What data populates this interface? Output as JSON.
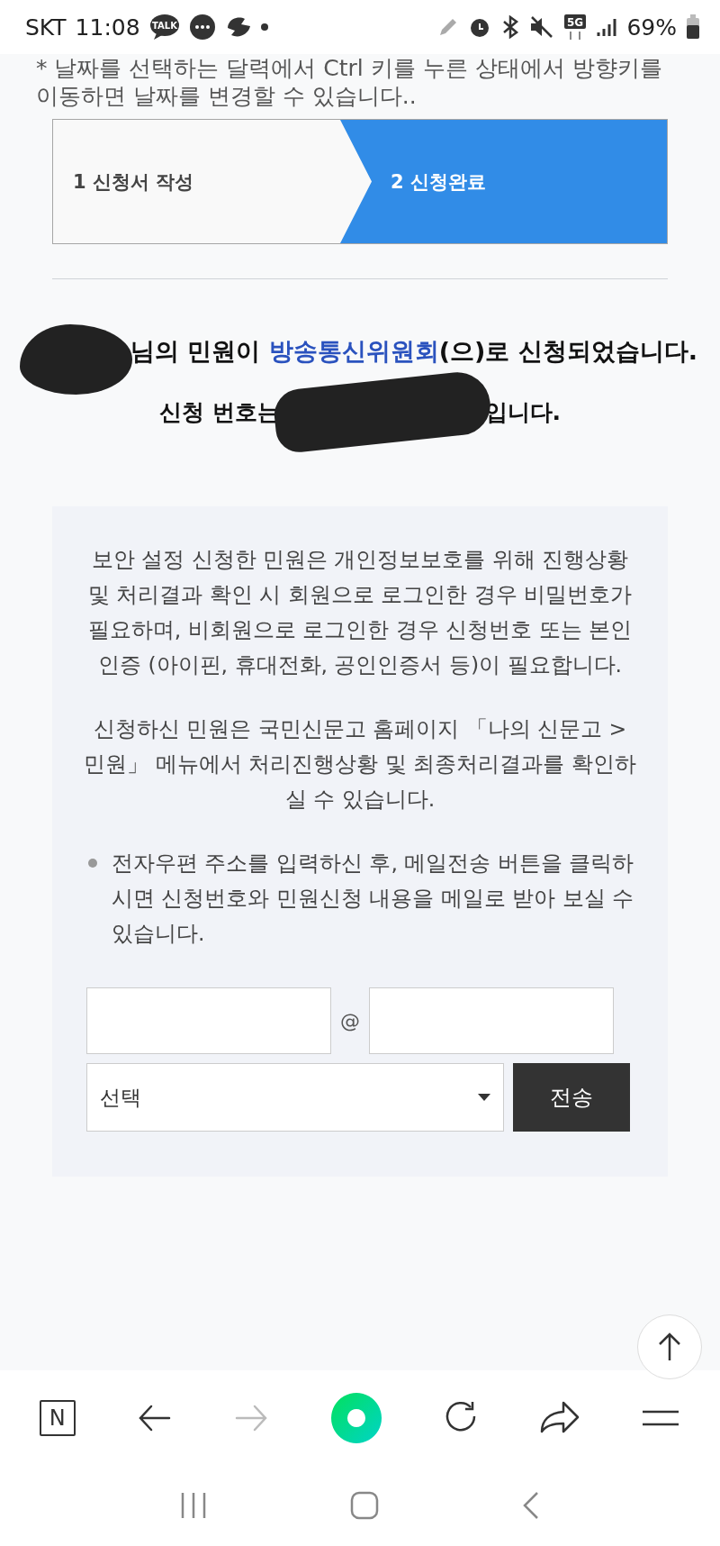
{
  "status_bar": {
    "carrier": "SKT",
    "time": "11:08",
    "talk_badge": "TALK",
    "network": "5G",
    "battery": "69%"
  },
  "notice": "* 날짜를 선택하는 달력에서 Ctrl 키를 누른 상태에서 방향키를 이동하면 날짜를 변경할 수 있습니다..",
  "steps": [
    {
      "label": "1 신청서 작성",
      "selected": false
    },
    {
      "label": "2 신청완료",
      "selected": true
    }
  ],
  "result": {
    "line_1_before": "님의 민원이 ",
    "agency_link": "방송통신위원회",
    "line_1_after": "(으)로 신청되었습니다.",
    "number_prefix": "신청 번호는",
    "number_suffix": "입니다."
  },
  "info": {
    "paragraphs": [
      "보안 설정 신청한 민원은 개인정보보호를 위해 진행상황 및 처리결과 확인 시 회원으로 로그인한 경우 비밀번호가 필요하며, 비회원으로 로그인한 경우 신청번호 또는 본인인증 (아이핀, 휴대전화, 공인인증서 등)이 필요합니다.",
      "신청하신 민원은 국민신문고 홈페이지 「나의 신문고 > 민원」 메뉴에서 처리진행상황 및 최종처리결과를 확인하실 수 있습니다."
    ],
    "bullet": "전자우편 주소를 입력하신 후, 메일전송 버튼을 클릭하시면 신청번호와 민원신청 내용을 메일로 받아 보실 수 있습니다.",
    "email": {
      "at": "@",
      "domain_select": "선택",
      "send_button": "전송"
    }
  },
  "browser_toolbar": {
    "logo": "N",
    "back_disabled": false,
    "forward_disabled": true
  }
}
